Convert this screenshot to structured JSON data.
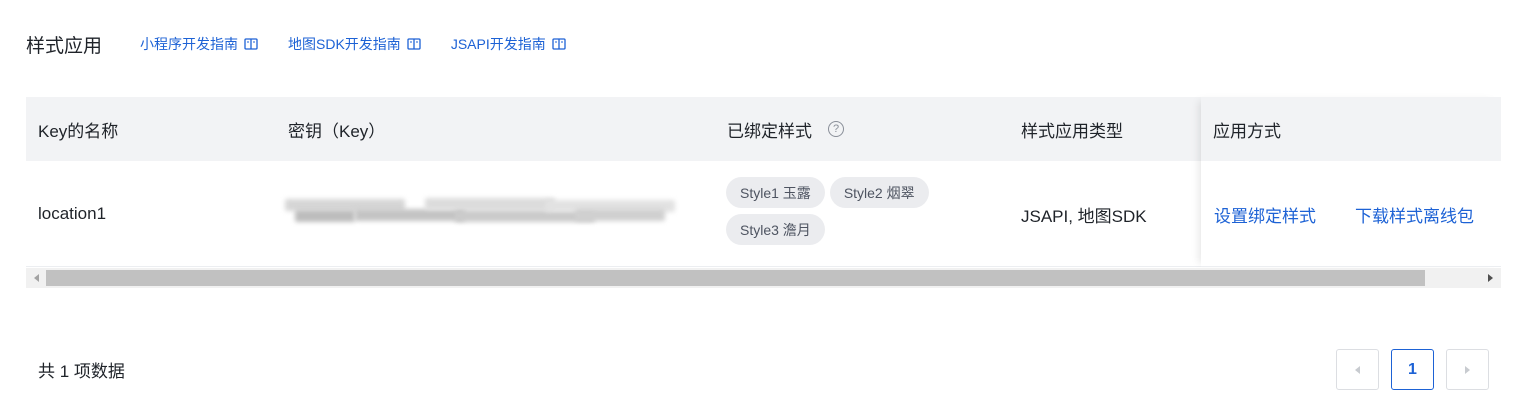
{
  "header": {
    "title": "样式应用",
    "guides": [
      {
        "label": "小程序开发指南",
        "icon": "book-icon"
      },
      {
        "label": "地图SDK开发指南",
        "icon": "book-icon"
      },
      {
        "label": "JSAPI开发指南",
        "icon": "book-icon"
      }
    ]
  },
  "table": {
    "columns": {
      "name": "Key的名称",
      "key": "密钥（Key）",
      "styles": "已绑定样式",
      "styles_help_icon": "question-circle-icon",
      "type": "样式应用类型",
      "actions": "应用方式"
    },
    "rows": [
      {
        "name": "location1",
        "key_hidden": true,
        "styles": [
          "Style1 玉露",
          "Style2 烟翠",
          "Style3 澹月"
        ],
        "type": "JSAPI, 地图SDK",
        "actions": [
          "设置绑定样式",
          "下载样式离线包"
        ]
      }
    ]
  },
  "footer": {
    "total_text": "共 1 项数据",
    "page": "1",
    "prev_icon": "chevron-left-icon",
    "next_icon": "chevron-right-icon"
  },
  "colors": {
    "link": "#1d62d5",
    "header_bg": "#f2f3f5",
    "tag_bg": "#ebecef"
  }
}
